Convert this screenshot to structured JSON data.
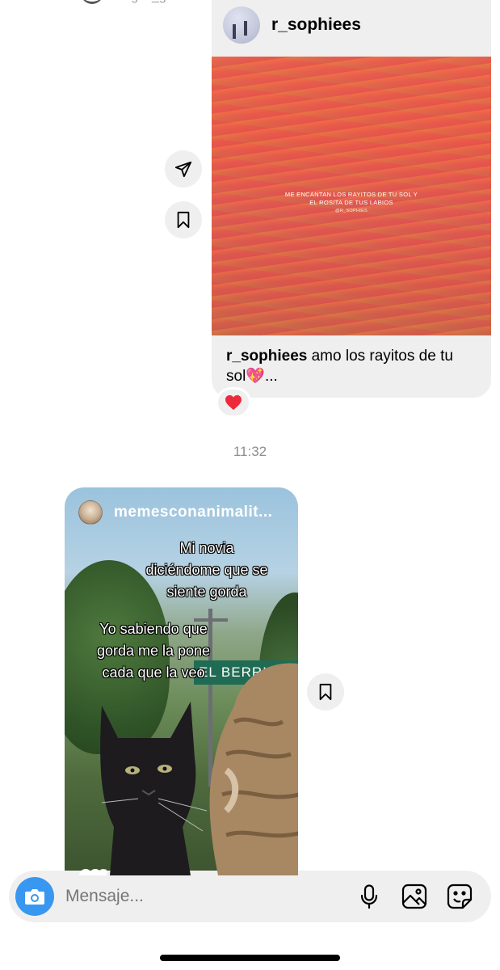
{
  "header": {
    "username_partial": "ragos_galindo"
  },
  "shared_post": {
    "username": "r_sophiees",
    "image_text_line1": "ME ENCANTAN LOS RAYITOS DE TU SOL Y",
    "image_text_line2": "EL ROSITA DE TUS LABIOS",
    "image_text_handle": "@R_SOPHIES",
    "caption_user": "r_sophiees",
    "caption_text": "amo los rayitos de tu sol💖...",
    "reaction": "❤️"
  },
  "actions": {
    "share_icon": "send-icon",
    "save_icon": "bookmark-icon"
  },
  "timestamp": "11:32",
  "reel": {
    "username": "memesconanimalit...",
    "meme_top_text": "Mi novia diciéndome que se siente gorda",
    "meme_middle_text": "Yo sabiendo que gorda me la pone cada que la veo",
    "sign_text": "EL BERRIN"
  },
  "composer": {
    "placeholder": "Mensaje...",
    "camera_icon": "camera-icon",
    "mic_icon": "microphone-icon",
    "gallery_icon": "image-icon",
    "sticker_icon": "sticker-icon"
  },
  "colors": {
    "accent": "#3897f0",
    "bubble": "#efefef",
    "muted_text": "#8e8e8e"
  }
}
